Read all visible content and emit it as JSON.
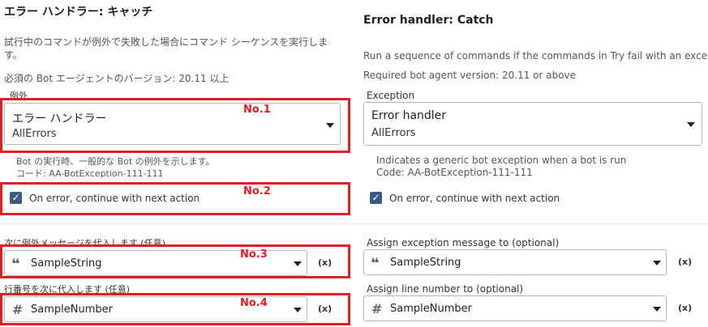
{
  "left": {
    "title": "エラー ハンドラー: キャッチ",
    "description": "試行中のコマンドが例外で失敗した場合にコマンド シーケンスを実行しま す。",
    "required": "必須の Bot エージェントのバージョン: 20.11 以上",
    "exception_label": "例外",
    "exception_value": "エラー ハンドラー",
    "exception_sub": "AllErrors",
    "hint_line1": "Bot の実行時、一般的な Bot の例外を示します。",
    "hint_line2": "コード: AA-BotException-111-111",
    "checkbox_label": "On error, continue with next action",
    "assign_msg_label": "次に例外メッセージを代入します (任意)",
    "assign_msg_value": "SampleString",
    "assign_line_label": "行番号を次に代入します (任意)",
    "assign_line_value": "SampleNumber"
  },
  "right": {
    "title": "Error handler: Catch",
    "description": "Run a sequence of commands if the commands in Try fail with an exception.",
    "required": "Required bot agent version: 20.11 or above",
    "exception_label": "Exception",
    "exception_value": "Error handler",
    "exception_sub": "AllErrors",
    "hint_line1": "Indicates a generic bot exception when a bot is run",
    "hint_line2": "Code: AA-BotException-111-111",
    "checkbox_label": "On error, continue with next action",
    "assign_msg_label": "Assign exception message to (optional)",
    "assign_msg_value": "SampleString",
    "assign_line_label": "Assign line number to (optional)",
    "assign_line_value": "SampleNumber"
  },
  "variable_button": "(x)",
  "annotations": [
    "No.1",
    "No.2",
    "No.3",
    "No.4"
  ],
  "colors": {
    "highlight": "#e11d25",
    "checkbox": "#3d5a80"
  },
  "icons": {
    "string": "quote-icon",
    "number": "hash-icon",
    "dropdown": "caret-down-icon"
  }
}
